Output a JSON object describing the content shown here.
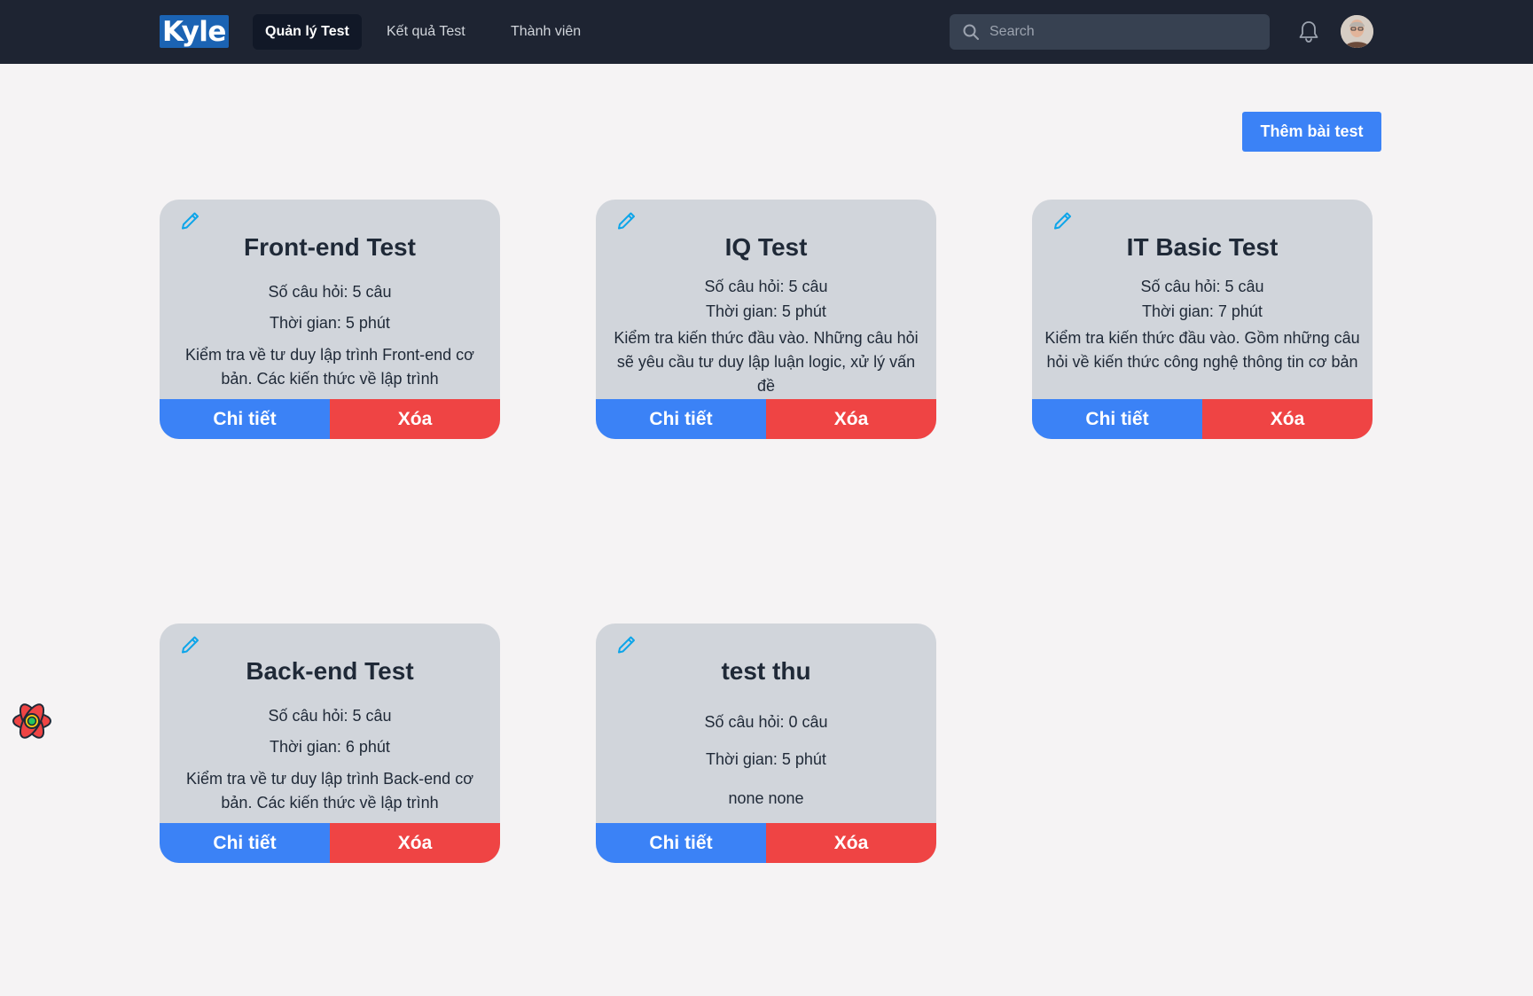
{
  "brand": {
    "logo_text": "Kyle"
  },
  "nav": {
    "items": [
      {
        "label": "Quản lý Test",
        "active": true
      },
      {
        "label": "Kết quả Test",
        "active": false
      },
      {
        "label": "Thành viên",
        "active": false
      }
    ]
  },
  "search": {
    "placeholder": "Search",
    "value": ""
  },
  "header_icons": {
    "notifications": "bell-icon",
    "avatar": "user-avatar"
  },
  "toolbar": {
    "add_label": "Thêm bài test"
  },
  "cards": [
    {
      "title": "Front-end Test",
      "questions": "Số câu hỏi: 5 câu",
      "time": "Thời gian: 5 phút",
      "description": "Kiểm tra về tư duy lập trình Front-end cơ bản. Các kiến thức về lập trình",
      "detail_label": "Chi tiết",
      "delete_label": "Xóa"
    },
    {
      "title": "IQ Test",
      "questions": "Số câu hỏi: 5 câu",
      "time": "Thời gian: 5 phút",
      "description": "Kiểm tra kiến thức đầu vào. Những câu hỏi sẽ yêu cầu tư duy lập luận logic, xử lý vấn đề",
      "detail_label": "Chi tiết",
      "delete_label": "Xóa"
    },
    {
      "title": "IT Basic Test",
      "questions": "Số câu hỏi: 5 câu",
      "time": "Thời gian: 7 phút",
      "description": "Kiểm tra kiến thức đầu vào. Gồm những câu hỏi về kiến thức công nghệ thông tin cơ bản",
      "detail_label": "Chi tiết",
      "delete_label": "Xóa"
    },
    {
      "title": "Back-end Test",
      "questions": "Số câu hỏi: 5 câu",
      "time": "Thời gian: 6 phút",
      "description": "Kiểm tra về tư duy lập trình Back-end cơ bản. Các kiến thức về lập trình",
      "detail_label": "Chi tiết",
      "delete_label": "Xóa"
    },
    {
      "title": "test thu",
      "questions": "Số câu hỏi: 0 câu",
      "time": "Thời gian: 5 phút",
      "description": "none none",
      "detail_label": "Chi tiết",
      "delete_label": "Xóa"
    }
  ],
  "colors": {
    "navbar": "#1e2432",
    "primary": "#3b82f6",
    "danger": "#ef4444",
    "card": "#d1d5db",
    "page": "#f5f3f4"
  }
}
